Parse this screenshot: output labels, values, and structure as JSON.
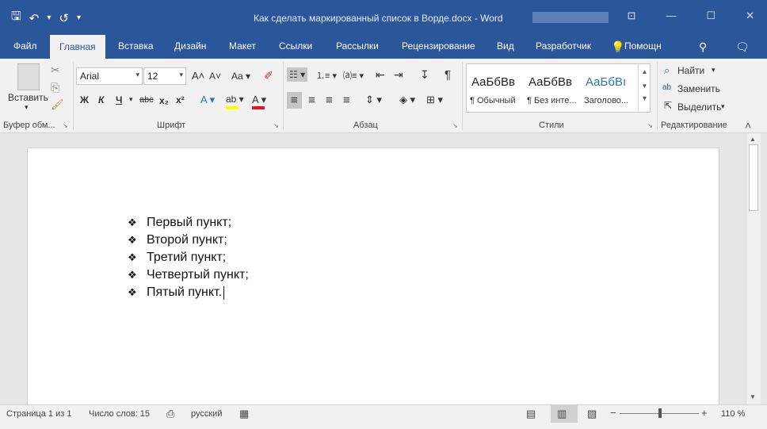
{
  "titlebar": {
    "title": "Как сделать маркированный список в Ворде.docx - Word",
    "qat": {
      "save": "🖫",
      "undo": "↶",
      "undo_dropdown": "▾",
      "redo": "↺",
      "customize": "▾"
    },
    "window_buttons": {
      "ribbon_options": "⊡",
      "minimize": "—",
      "maximize": "☐",
      "close": "✕"
    }
  },
  "tabs": [
    "Файл",
    "Главная",
    "Вставка",
    "Дизайн",
    "Макет",
    "Ссылки",
    "Рассылки",
    "Рецензирование",
    "Вид",
    "Разработчик"
  ],
  "tellme": "Помощн",
  "tabs_right": {
    "tellme_icon": "💡",
    "account": "⚲",
    "comments": "🗨"
  },
  "ribbon": {
    "clipboard": {
      "paste_label": "Вставить",
      "paste_arrow": "▾",
      "cut": "✂",
      "copy": "⎘",
      "format_painter": "🖌",
      "group_label": "Буфер обм..."
    },
    "font": {
      "font_name": "Arial",
      "font_size": "12",
      "grow": "A˄",
      "shrink": "A˅",
      "change_case": "Aa ▾",
      "clear_format": "✐",
      "bold": "Ж",
      "italic": "К",
      "underline": "Ч",
      "underline_arrow": "▾",
      "strike": "abc",
      "subscript": "x₂",
      "superscript": "x²",
      "text_effects": "A ▾",
      "highlight": "ab ▾",
      "font_color": "A ▾",
      "group_label": "Шрифт"
    },
    "paragraph": {
      "bullets": "☷ ▾",
      "numbering": "⒈≡ ▾",
      "multilevel": "⒜≡ ▾",
      "decrease_indent": "⇤",
      "increase_indent": "⇥",
      "sort": "↧",
      "pilcrow": "¶",
      "align_left": "≡",
      "align_center": "≡",
      "align_right": "≡",
      "justify": "≡",
      "line_spacing": "⇕ ▾",
      "shading": "◈ ▾",
      "borders": "⊞ ▾",
      "group_label": "Абзац"
    },
    "styles": {
      "items": [
        {
          "sample": "АаБбВв",
          "name": "¶ Обычный"
        },
        {
          "sample": "АаБбВв",
          "name": "¶ Без инте..."
        },
        {
          "sample": "АаБбВı",
          "name": "Заголово..."
        }
      ],
      "scroll_up": "▲",
      "scroll_down": "▼",
      "more": "▾",
      "group_label": "Стили"
    },
    "editing": {
      "find": "Найти",
      "find_icon": "⌕",
      "find_arrow": "▾",
      "replace": "Заменить",
      "replace_icon": "ab",
      "select": "Выделить",
      "select_icon": "⇱",
      "select_arrow": "▾",
      "group_label": "Редактирование",
      "collapse": "˄"
    },
    "launcher": "↘"
  },
  "document": {
    "bullet": "❖",
    "items": [
      "Первый пункт;",
      "Второй пункт;",
      "Третий пункт;",
      "Четвертый пункт;",
      "Пятый пункт."
    ]
  },
  "scrollbar": {
    "up": "▲",
    "down": "▼"
  },
  "statusbar": {
    "page": "Страница 1 из 1",
    "words": "Число слов: 15",
    "proofing_icon": "⎙",
    "language": "русский",
    "macro_icon": "▦",
    "read_mode": "▤",
    "print_layout": "▥",
    "web_layout": "▧",
    "zoom_out": "−",
    "zoom_in": "+",
    "zoom": "110 %"
  },
  "colors": {
    "accent": "#2b579a",
    "ribbon_bg": "#f1f1f1",
    "styles_heading": "#2e74b5",
    "font_color_bar": "#e81123",
    "highlight_bar": "#ffff00"
  }
}
